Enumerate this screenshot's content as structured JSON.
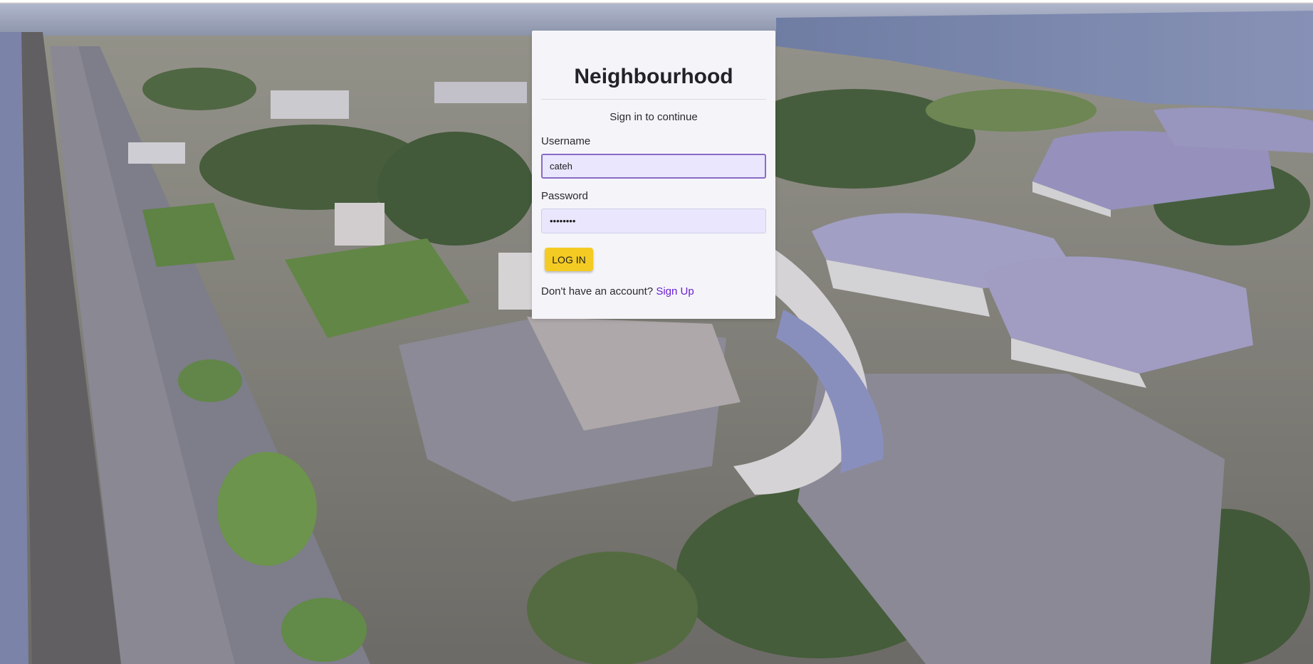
{
  "app": {
    "title": "Neighbourhood",
    "subtitle": "Sign in to continue"
  },
  "form": {
    "username_label": "Username",
    "username_value": "cateh",
    "password_label": "Password",
    "password_value": "password",
    "login_label": "LOG IN",
    "signup_prompt": "Don't have an account?",
    "signup_link": "Sign Up"
  },
  "background": {
    "description_icon": "aerial-photo-background"
  },
  "colors": {
    "accent_button": "#f4cb22",
    "link": "#6a1ed1",
    "input_fill": "#e9e6fd",
    "focus_border": "#8a6bc7"
  }
}
